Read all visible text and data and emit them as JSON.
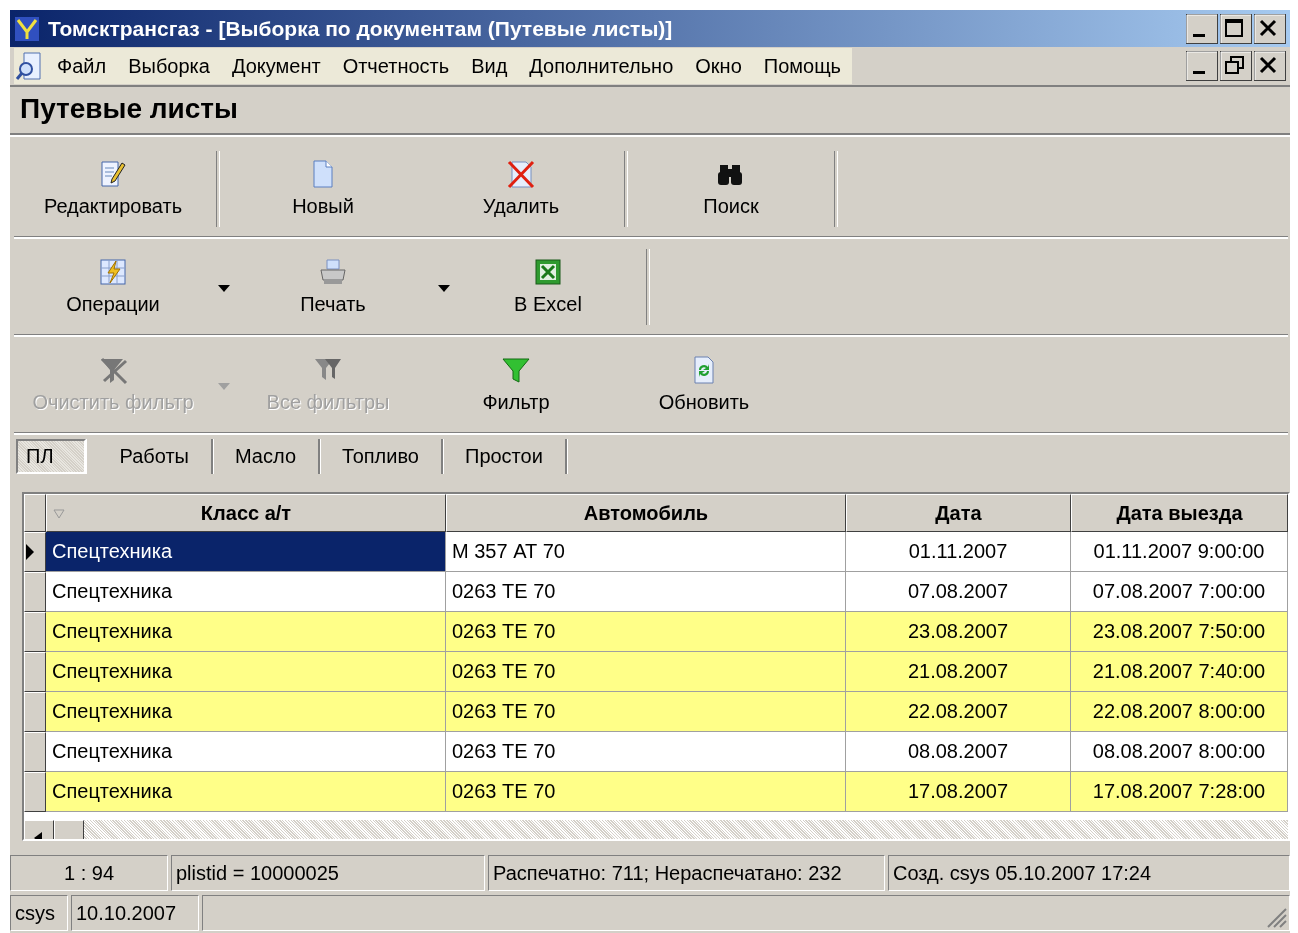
{
  "window": {
    "title": "Томсктрансгаз - [Выборка по документам (Путевые листы)]"
  },
  "menu": [
    "Файл",
    "Выборка",
    "Документ",
    "Отчетность",
    "Вид",
    "Дополнительно",
    "Окно",
    "Помощь"
  ],
  "heading": "Путевые листы",
  "toolbars": [
    {
      "buttons": [
        {
          "label": "Редактировать",
          "disabled": false,
          "dropdown": false,
          "separator_after": true
        },
        {
          "label": "Новый",
          "disabled": false,
          "dropdown": false,
          "separator_after": false
        },
        {
          "label": "Удалить",
          "disabled": false,
          "dropdown": false,
          "separator_after": true
        },
        {
          "label": "Поиск",
          "disabled": false,
          "dropdown": false,
          "separator_after": true
        }
      ]
    },
    {
      "buttons": [
        {
          "label": "Операции",
          "disabled": false,
          "dropdown": true,
          "separator_after": false
        },
        {
          "label": "Печать",
          "disabled": false,
          "dropdown": true,
          "separator_after": false
        },
        {
          "label": "В Excel",
          "disabled": false,
          "dropdown": false,
          "separator_after": true
        }
      ]
    },
    {
      "buttons": [
        {
          "label": "Очистить фильтр",
          "disabled": true,
          "dropdown": true,
          "separator_after": false
        },
        {
          "label": "Все фильтры",
          "disabled": true,
          "dropdown": false,
          "separator_after": false
        },
        {
          "label": "Фильтр",
          "disabled": false,
          "dropdown": false,
          "separator_after": false
        },
        {
          "label": "Обновить",
          "disabled": false,
          "dropdown": false,
          "separator_after": false
        }
      ]
    }
  ],
  "tabs": [
    {
      "label": "ПЛ",
      "selected": true
    },
    {
      "label": "Работы",
      "selected": false
    },
    {
      "label": "Масло",
      "selected": false
    },
    {
      "label": "Топливо",
      "selected": false
    },
    {
      "label": "Простои",
      "selected": false
    }
  ],
  "table": {
    "columns": [
      "Класс а/т",
      "Автомобиль",
      "Дата",
      "Дата выезда"
    ],
    "rows": [
      {
        "selected": true,
        "highlighted": false,
        "cells": [
          "Спецтехника",
          "М 357 АТ 70",
          "01.11.2007",
          "01.11.2007 9:00:00"
        ]
      },
      {
        "selected": false,
        "highlighted": false,
        "cells": [
          "Спецтехника",
          "0263 ТЕ 70",
          "07.08.2007",
          "07.08.2007 7:00:00"
        ]
      },
      {
        "selected": false,
        "highlighted": true,
        "cells": [
          "Спецтехника",
          "0263 ТЕ 70",
          "23.08.2007",
          "23.08.2007 7:50:00"
        ]
      },
      {
        "selected": false,
        "highlighted": true,
        "cells": [
          "Спецтехника",
          "0263 ТЕ 70",
          "21.08.2007",
          "21.08.2007 7:40:00"
        ]
      },
      {
        "selected": false,
        "highlighted": true,
        "cells": [
          "Спецтехника",
          "0263 ТЕ 70",
          "22.08.2007",
          "22.08.2007 8:00:00"
        ]
      },
      {
        "selected": false,
        "highlighted": false,
        "cells": [
          "Спецтехника",
          "0263 ТЕ 70",
          "08.08.2007",
          "08.08.2007 8:00:00"
        ]
      },
      {
        "selected": false,
        "highlighted": true,
        "cells": [
          "Спецтехника",
          "0263 ТЕ 70",
          "17.08.2007",
          "17.08.2007 7:28:00"
        ]
      }
    ]
  },
  "status_bar": [
    "1 : 94",
    "plistid = 10000025",
    "Распечатно: 711; Нераспечатано: 232",
    "Созд. csys 05.10.2007 17:24"
  ],
  "status_bar_2": [
    "csys",
    "10.10.2007"
  ]
}
